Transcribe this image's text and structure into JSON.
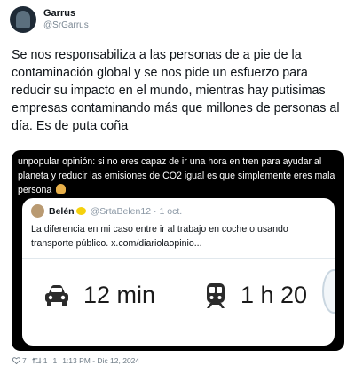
{
  "author": {
    "display_name": "Garrus",
    "handle": "@SrGarrus"
  },
  "tweet": {
    "text": "Se nos responsabiliza a las personas de a pie de la contaminación global y se nos pide un esfuerzo para reducir su impacto en el mundo, mientras hay putisimas empresas contaminando más que millones de personas al día. Es de puta coña"
  },
  "media": {
    "caption": "unpopular opinión: si no eres capaz de ir una hora en tren para ayudar al planeta y reducir las emisiones de CO2 igual es que simplemente eres mala persona",
    "quote": {
      "name": "Belén",
      "handle": "@SrtaBelen12",
      "separator": "·",
      "date": "1 oct.",
      "text": "La diferencia en mi caso entre ir al trabajo en coche o usando transporte público.  x.com/diariolaopinio...",
      "car_time": "12 min",
      "train_time": "1 h 20"
    }
  },
  "footer": {
    "likes": "7",
    "retweets": "1",
    "replies": "1",
    "timestamp": "1:13 PM - Dic 12, 2024"
  },
  "icons": [
    "heart-icon",
    "retweet-icon",
    "reply-icon",
    "car-icon",
    "train-icon"
  ]
}
